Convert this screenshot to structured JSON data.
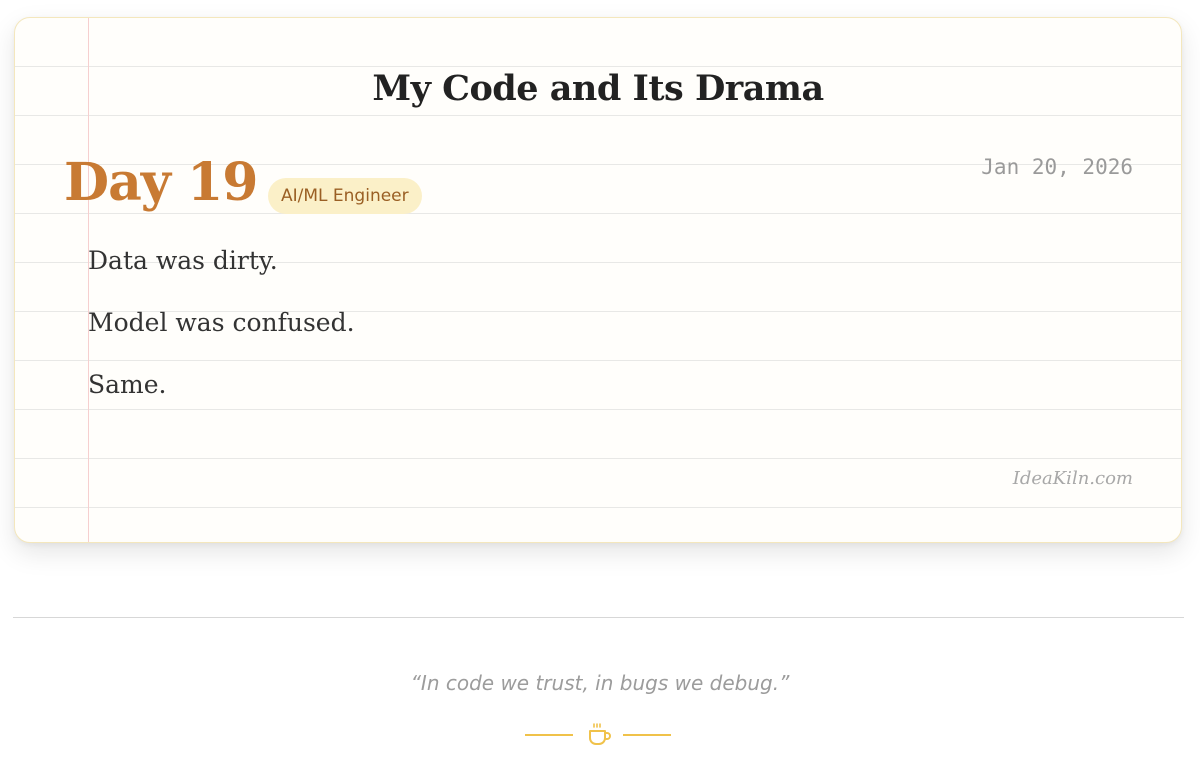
{
  "card": {
    "title": "My Code and Its Drama",
    "day_label": "Day 19",
    "role_badge": "AI/ML Engineer",
    "date": "Jan 20, 2026",
    "entries": [
      "Data was dirty.",
      "Model was confused.",
      "Same."
    ],
    "watermark": "IdeaKiln.com"
  },
  "footer": {
    "quote": "“In code we trust, in bugs we debug.”",
    "ornament_icon": "coffee-cup-icon"
  },
  "colors": {
    "accent": "#c87a33",
    "badge_bg": "#fbf0c8",
    "ornament": "#f0c24a"
  }
}
